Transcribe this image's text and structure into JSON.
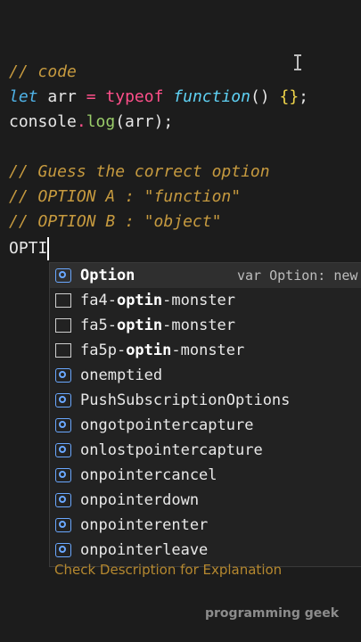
{
  "code": {
    "line1": "// code",
    "line2": {
      "kw": "let",
      "var": " arr ",
      "op1": "=",
      "sp1": " ",
      "op2": "typeof",
      "sp2": " ",
      "fn": "function",
      "rest": "() ",
      "braces": "{}",
      "semi": ";"
    },
    "line3": {
      "obj": "console",
      "dot": ".",
      "method": "log",
      "args": "(arr);"
    },
    "line4": "// Guess the correct option",
    "line5": "// OPTION A : \"function\"",
    "line6": "// OPTION B : \"object\"",
    "line7": "OPTI"
  },
  "suggestions": [
    {
      "icon": "variable-icon",
      "bold": "Option",
      "rest": "",
      "detail": "var Option: new",
      "active": true
    },
    {
      "icon": "box-icon",
      "pre": "fa4-",
      "bold": "optin",
      "rest": "-monster"
    },
    {
      "icon": "box-icon",
      "pre": "fa5-",
      "bold": "optin",
      "rest": "-monster"
    },
    {
      "icon": "box-icon",
      "pre": "fa5p-",
      "bold": "optin",
      "rest": "-monster"
    },
    {
      "icon": "variable-icon",
      "text": "onemptied"
    },
    {
      "icon": "variable-icon",
      "text": "PushSubscriptionOptions"
    },
    {
      "icon": "variable-icon",
      "text": "ongotpointercapture"
    },
    {
      "icon": "variable-icon",
      "text": "onlostpointercapture"
    },
    {
      "icon": "variable-icon",
      "text": "onpointercancel"
    },
    {
      "icon": "variable-icon",
      "text": "onpointerdown"
    },
    {
      "icon": "variable-icon",
      "text": "onpointerenter"
    },
    {
      "icon": "variable-icon",
      "text": "onpointerleave"
    }
  ],
  "caption": "Check Description for Explanation",
  "brand": "programming geek"
}
